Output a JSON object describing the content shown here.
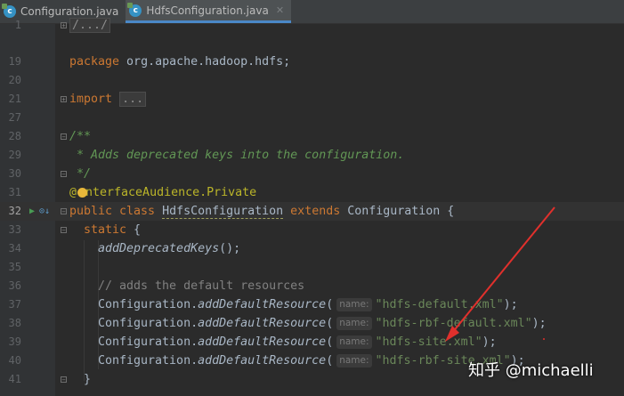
{
  "tabs": [
    {
      "label": "Configuration.java",
      "active": false,
      "icon": "c"
    },
    {
      "label": "HdfsConfiguration.java",
      "active": true,
      "icon": "c"
    }
  ],
  "lines": {
    "l1": "1",
    "l19": "19",
    "l20": "20",
    "l21": "21",
    "l27": "27",
    "l28": "28",
    "l29": "29",
    "l30": "30",
    "l31": "31",
    "l32": "32",
    "l33": "33",
    "l34": "34",
    "l35": "35",
    "l36": "36",
    "l37": "37",
    "l38": "38",
    "l39": "39",
    "l40": "40",
    "l41": "41"
  },
  "code": {
    "license_fold": "/.../",
    "package_kw": "package",
    "package_name": " org.apache.hadoop.hdfs;",
    "import_kw": "import",
    "import_fold": "...",
    "doc_open": "/**",
    "doc_line": " * Adds deprecated keys into the configuration.",
    "doc_close": " */",
    "ann_at": "@",
    "ann_rest": "nterfaceAudience.",
    "ann_private": "Private",
    "class_mod": "public class ",
    "class_name": "HdfsConfiguration",
    "extends_kw": " extends ",
    "super_name": "Configuration {",
    "static_kw": "static",
    "static_brace": " {",
    "add_dep": "addDeprecatedKeys",
    "add_dep_tail": "();",
    "comment": "// adds the default resources",
    "conf": "Configuration.",
    "method": "addDefaultResource",
    "paren_open": "(",
    "param_hint": "name:",
    "r1": "\"hdfs-default.xml\"",
    "r2": "\"hdfs-rbf-default.xml\"",
    "r3": "\"hdfs-site.xml\"",
    "r4": "\"hdfs-rbf-site.xml\"",
    "tail": ");",
    "close_brace": "}"
  },
  "watermark": "知乎 @michaelli",
  "colors": {
    "background": "#2b2b2b",
    "keyword": "#cc7832",
    "string": "#6a8759",
    "javadoc": "#629755",
    "annotation": "#bbb529",
    "arrow": "#e0302c"
  }
}
